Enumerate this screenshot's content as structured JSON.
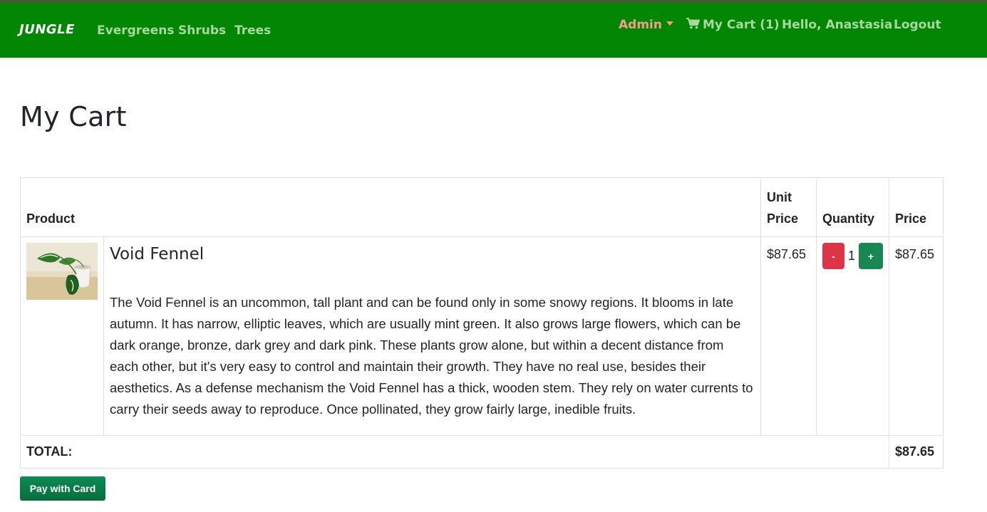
{
  "nav": {
    "brand": "JUNGLE",
    "links": [
      "Evergreens",
      "Shrubs",
      "Trees"
    ],
    "admin": "Admin",
    "cart": "My Cart (1)",
    "greeting": "Hello, Anastasia",
    "logout": "Logout"
  },
  "page_title": "My Cart",
  "table": {
    "headers": {
      "product": "Product",
      "unit_price_1": "Unit",
      "unit_price_2": "Price",
      "quantity": "Quantity",
      "price": "Price"
    },
    "rows": [
      {
        "name": "Void Fennel",
        "description": "The Void Fennel is an uncommon, tall plant and can be found only in some snowy regions. It blooms in late autumn. It has narrow, elliptic leaves, which are usually mint green. It also grows large flowers, which can be dark orange, bronze, dark grey and dark pink. These plants grow alone, but within a decent distance from each other, but it's very easy to control and maintain their growth. They have no real use, besides their aesthetics. As a defense mechanism the Void Fennel has a thick, wooden stem. They rely on water currents to carry their seeds away to reproduce. Once pollinated, they grow fairly large, inedible fruits.",
        "unit_price": "$87.65",
        "quantity": "1",
        "decrement": "-",
        "increment": "+",
        "price": "$87.65"
      }
    ],
    "total_label": "TOTAL:",
    "total_value": "$87.65"
  },
  "pay_button": "Pay with Card",
  "colors": {
    "navbar": "#038603",
    "admin": "#f0a089",
    "minus": "#dc3545",
    "plus": "#198754",
    "pay": "#0b7a48"
  },
  "icons": [
    "cart-icon",
    "caret-down-icon",
    "product-image"
  ]
}
